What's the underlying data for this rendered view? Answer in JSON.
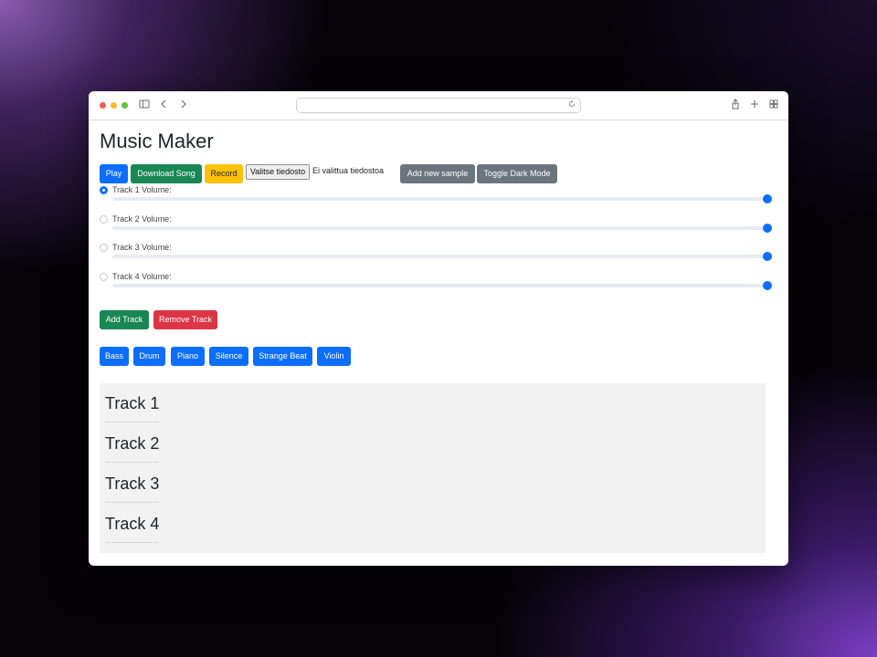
{
  "app": {
    "title": "Music Maker",
    "address_url": ""
  },
  "toolbar": {
    "play_label": "Play",
    "download_label": "Download Song",
    "record_label": "Record",
    "file_button_label": "Valitse tiedosto",
    "file_status": "Ei valittua tiedostoa",
    "add_sample_label": "Add new sample",
    "dark_mode_label": "Toggle Dark Mode"
  },
  "tracks": [
    {
      "label": "Track 1 Volume:",
      "selected": true,
      "volume": 1.0
    },
    {
      "label": "Track 2 Volume:",
      "selected": false,
      "volume": 1.0
    },
    {
      "label": "Track 3 Volume:",
      "selected": false,
      "volume": 1.0
    },
    {
      "label": "Track 4 Volume:",
      "selected": false,
      "volume": 1.0
    }
  ],
  "track_actions": {
    "add_label": "Add Track",
    "remove_label": "Remove Track"
  },
  "samples": [
    "Bass",
    "Drum",
    "Piano",
    "Silence",
    "Strange Beat",
    "Violin"
  ],
  "track_panel": [
    "Track 1",
    "Track 2",
    "Track 3",
    "Track 4"
  ],
  "colors": {
    "primary": "#0d6efd",
    "success": "#198754",
    "warning": "#ffc107",
    "secondary": "#6c757d",
    "danger": "#dc3545"
  },
  "icons": {
    "sidebar": "sidebar-icon",
    "back": "chevron-left-icon",
    "forward": "chevron-right-icon",
    "share": "share-icon",
    "new_tab": "plus-icon",
    "tabs": "tab-overview-icon",
    "reload": "reload-icon"
  }
}
